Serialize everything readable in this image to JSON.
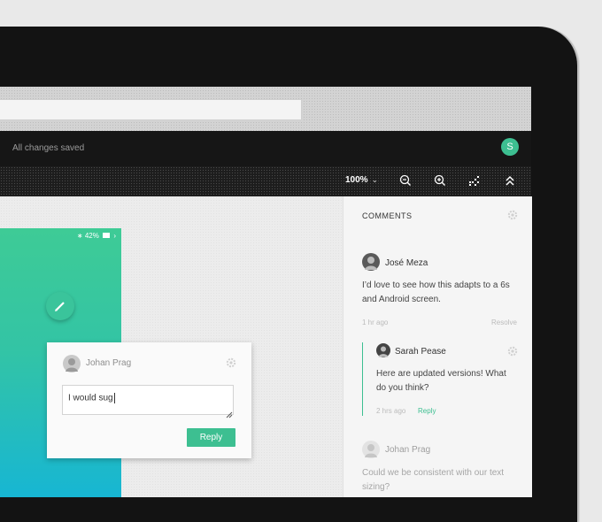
{
  "header": {
    "saved_status": "All changes saved",
    "avatar_initial": "S"
  },
  "toolbar": {
    "zoom_value": "100%",
    "icons": [
      "zoom-out-icon",
      "zoom-in-icon",
      "grid-icon",
      "collapse-icon"
    ]
  },
  "phone": {
    "battery": "42%"
  },
  "popup": {
    "author": "Johan Prag",
    "input_value": "I would sug",
    "reply_label": "Reply"
  },
  "comments": {
    "title": "COMMENTS",
    "items": [
      {
        "author": "José Meza",
        "text_line1": "I’d love to see how this adapts to a 6s",
        "text_line2": "and Android screen.",
        "time": "1 hr ago",
        "action": "Resolve"
      },
      {
        "author": "Sarah Pease",
        "text_line1": "Here are updated versions! What",
        "text_line2": "do you think?",
        "time": "2 hrs ago",
        "action": "Reply"
      },
      {
        "author": "Johan Prag",
        "text_line1": "Could we be consistent with our text",
        "text_line2": "sizing?"
      }
    ]
  },
  "colors": {
    "accent": "#3dbf91",
    "frame": "#131313",
    "phone_top": "#3ecb96",
    "phone_bottom": "#17b6d3"
  }
}
